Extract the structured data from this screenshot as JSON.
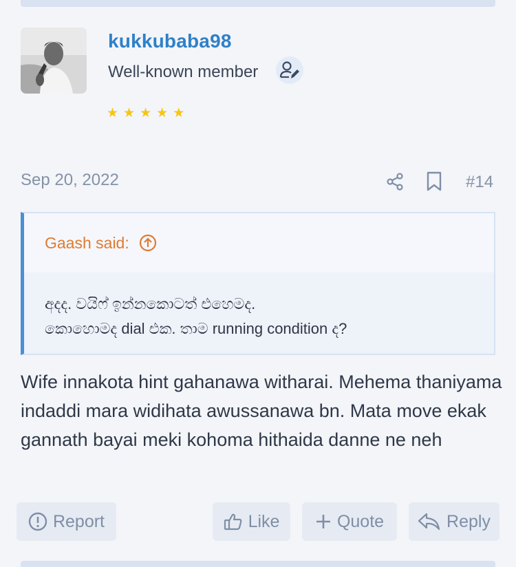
{
  "post": {
    "author": {
      "username": "kukkubaba98",
      "title": "Well-known member",
      "badge_icon": "user-pen-icon",
      "stars": 5,
      "star_color": "#f5c518",
      "username_color": "#2f80c8"
    },
    "date": "Sep 20, 2022",
    "number": "#14",
    "meta_icons": [
      "share-icon",
      "bookmark-icon"
    ],
    "quote": {
      "author": "Gaash said:",
      "author_color": "#e07a30",
      "lines": [
        "අදද. වයිෆ් ඉන්නකොටත් එහෙමද.",
        "කොහොමද dial එක. තාම running condition ද?"
      ]
    },
    "body": "Wife innakota hint gahanawa witharai. Mehema thaniyama indaddi mara widihata awussanawa bn. Mata move ekak gannath bayai meki kohoma hithaida danne ne neh"
  },
  "actions": {
    "report_label": "Report",
    "like_label": "Like",
    "quote_label": "Quote",
    "reply_label": "Reply"
  },
  "colors": {
    "accent": "#4a8fd6",
    "button_bg": "#e6ebf3",
    "button_text": "#7f8ea6"
  }
}
